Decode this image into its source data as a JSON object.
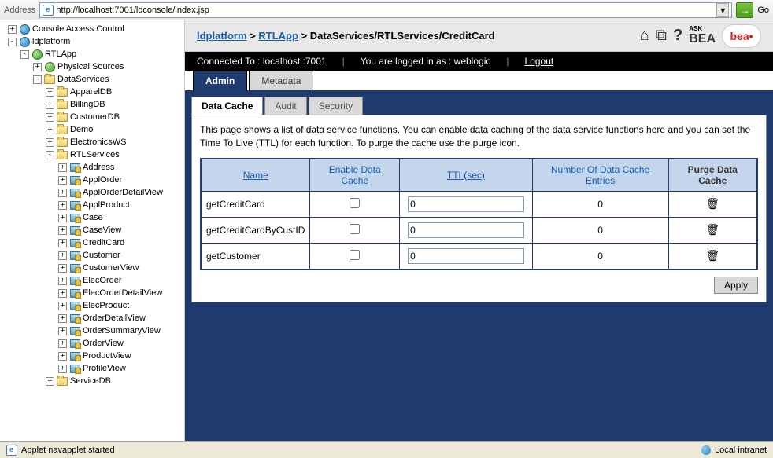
{
  "address": {
    "label": "Address",
    "url": "http://localhost:7001/ldconsole/index.jsp",
    "go": "Go"
  },
  "tree": [
    {
      "level": 0,
      "exp": "+",
      "icon": "globe",
      "label": "Console Access Control"
    },
    {
      "level": 0,
      "exp": "-",
      "icon": "globe",
      "label": "ldplatform"
    },
    {
      "level": 1,
      "exp": "-",
      "icon": "app",
      "label": "RTLApp"
    },
    {
      "level": 2,
      "exp": "+",
      "icon": "app",
      "label": "Physical Sources"
    },
    {
      "level": 2,
      "exp": "-",
      "icon": "folder",
      "label": "DataServices"
    },
    {
      "level": 3,
      "exp": "+",
      "icon": "folder",
      "label": "ApparelDB"
    },
    {
      "level": 3,
      "exp": "+",
      "icon": "folder",
      "label": "BillingDB"
    },
    {
      "level": 3,
      "exp": "+",
      "icon": "folder",
      "label": "CustomerDB"
    },
    {
      "level": 3,
      "exp": "+",
      "icon": "folder",
      "label": "Demo"
    },
    {
      "level": 3,
      "exp": "+",
      "icon": "folder",
      "label": "ElectronicsWS"
    },
    {
      "level": 3,
      "exp": "-",
      "icon": "folder",
      "label": "RTLServices"
    },
    {
      "level": 4,
      "exp": "+",
      "icon": "ds",
      "label": "Address"
    },
    {
      "level": 4,
      "exp": "+",
      "icon": "ds",
      "label": "ApplOrder"
    },
    {
      "level": 4,
      "exp": "+",
      "icon": "ds",
      "label": "ApplOrderDetailView"
    },
    {
      "level": 4,
      "exp": "+",
      "icon": "ds",
      "label": "ApplProduct"
    },
    {
      "level": 4,
      "exp": "+",
      "icon": "ds",
      "label": "Case"
    },
    {
      "level": 4,
      "exp": "+",
      "icon": "ds",
      "label": "CaseView"
    },
    {
      "level": 4,
      "exp": "+",
      "icon": "ds",
      "label": "CreditCard"
    },
    {
      "level": 4,
      "exp": "+",
      "icon": "ds",
      "label": "Customer"
    },
    {
      "level": 4,
      "exp": "+",
      "icon": "ds",
      "label": "CustomerView"
    },
    {
      "level": 4,
      "exp": "+",
      "icon": "ds",
      "label": "ElecOrder"
    },
    {
      "level": 4,
      "exp": "+",
      "icon": "ds",
      "label": "ElecOrderDetailView"
    },
    {
      "level": 4,
      "exp": "+",
      "icon": "ds",
      "label": "ElecProduct"
    },
    {
      "level": 4,
      "exp": "+",
      "icon": "ds",
      "label": "OrderDetailView"
    },
    {
      "level": 4,
      "exp": "+",
      "icon": "ds",
      "label": "OrderSummaryView"
    },
    {
      "level": 4,
      "exp": "+",
      "icon": "ds",
      "label": "OrderView"
    },
    {
      "level": 4,
      "exp": "+",
      "icon": "ds",
      "label": "ProductView"
    },
    {
      "level": 4,
      "exp": "+",
      "icon": "ds",
      "label": "ProfileView"
    },
    {
      "level": 3,
      "exp": "+",
      "icon": "folder",
      "label": "ServiceDB"
    }
  ],
  "breadcrumb": {
    "part1": "ldplatform",
    "part2": "RTLApp",
    "part3": "DataServices/RTLServices/CreditCard",
    "sep": " > "
  },
  "header_logo": {
    "ask": "ASK",
    "bea": "BEA",
    "badge": "bea"
  },
  "status_bar": {
    "connected": "Connected To :  localhost :7001",
    "logged_in": "You are logged in as :  weblogic",
    "logout": "Logout"
  },
  "tabs1": [
    {
      "label": "Admin",
      "active": true
    },
    {
      "label": "Metadata",
      "active": false
    }
  ],
  "tabs2": [
    {
      "label": "Data Cache",
      "active": true
    },
    {
      "label": "Audit",
      "active": false
    },
    {
      "label": "Security",
      "active": false
    }
  ],
  "desc": "This page shows a list of data service functions. You can enable data caching of the data service functions here and you can set the Time To Live (TTL) for each function. To purge the cache use the purge icon.",
  "table": {
    "headers": {
      "name": "Name",
      "enable": "Enable Data Cache",
      "ttl": "TTL(sec)",
      "entries": "Number Of Data Cache Entries",
      "purge": "Purge Data Cache"
    },
    "rows": [
      {
        "name": "getCreditCard",
        "enabled": false,
        "ttl": "0",
        "entries": "0"
      },
      {
        "name": "getCreditCardByCustID",
        "enabled": false,
        "ttl": "0",
        "entries": "0"
      },
      {
        "name": "getCustomer",
        "enabled": false,
        "ttl": "0",
        "entries": "0"
      }
    ]
  },
  "apply": "Apply",
  "bottom": {
    "left": "Applet navapplet started",
    "right": "Local intranet"
  }
}
